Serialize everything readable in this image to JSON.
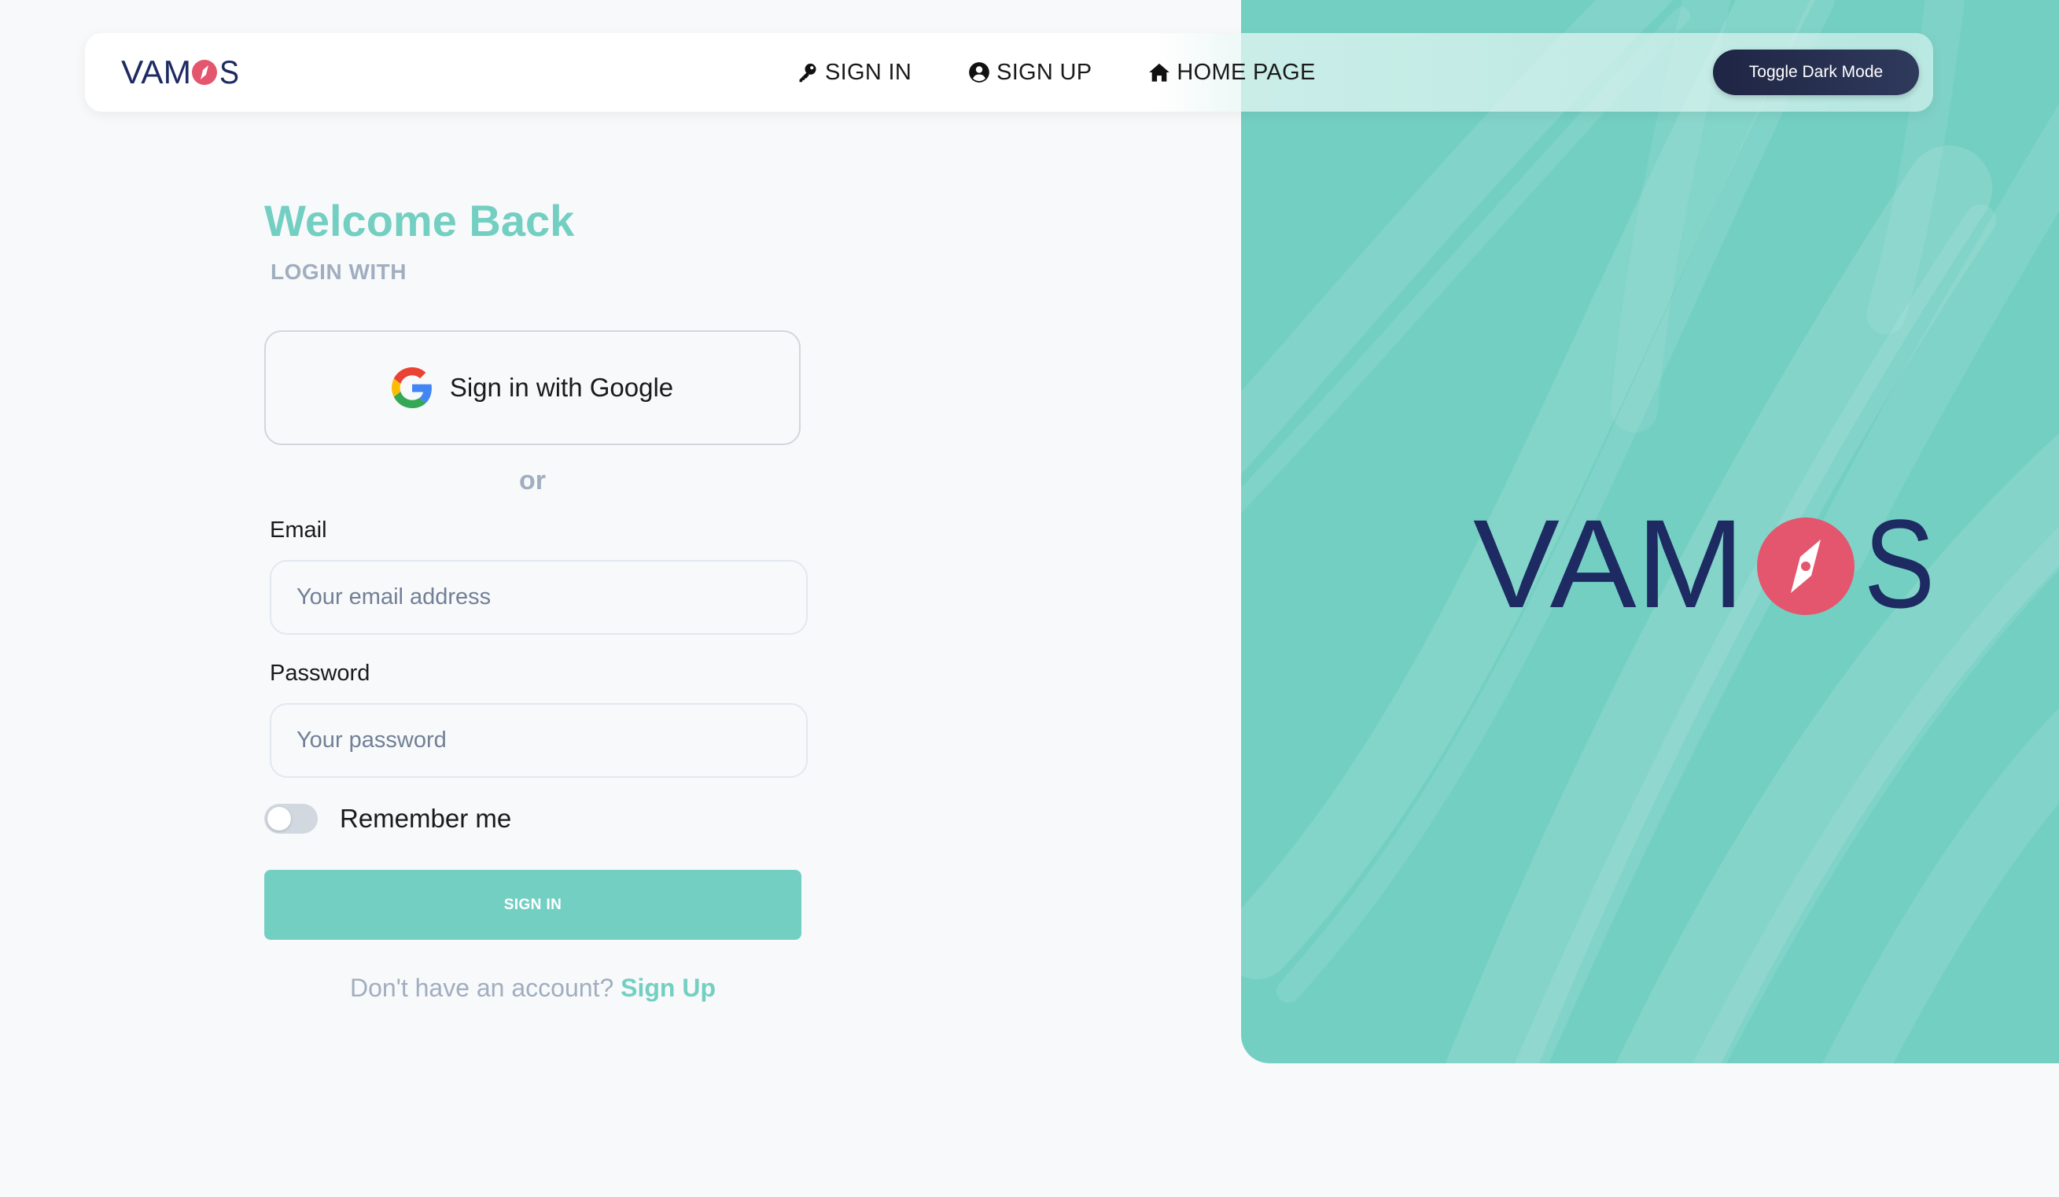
{
  "brand": {
    "name": "VAMOS",
    "logo_text_left": "VAM",
    "logo_text_right": "S",
    "navy": "#1e2b63",
    "coral": "#e4566d",
    "teal": "#74cfc3"
  },
  "nav": {
    "links": [
      {
        "label": "SIGN IN",
        "icon": "key-icon"
      },
      {
        "label": "SIGN UP",
        "icon": "user-circle-icon"
      },
      {
        "label": "HOME PAGE",
        "icon": "home-icon"
      }
    ],
    "dark_mode_label": "Toggle Dark Mode"
  },
  "form": {
    "title": "Welcome Back",
    "subtitle": "LOGIN WITH",
    "google_label": "Sign in with Google",
    "or_text": "or",
    "email": {
      "label": "Email",
      "placeholder": "Your email address",
      "value": ""
    },
    "password": {
      "label": "Password",
      "placeholder": "Your password",
      "value": ""
    },
    "remember": {
      "label": "Remember me",
      "checked": false
    },
    "submit_label": "SIGN IN",
    "signup_prompt": "Don't have an account?",
    "signup_link": "Sign Up"
  }
}
